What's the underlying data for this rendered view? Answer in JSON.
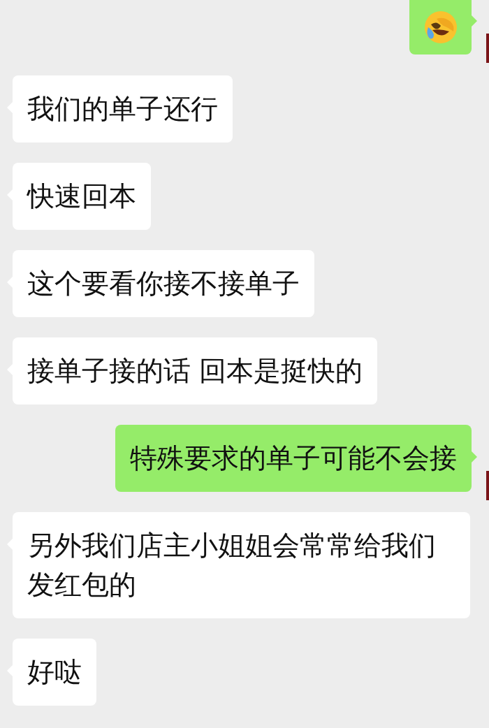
{
  "messages": [
    {
      "kind": "emoji",
      "outgoing": true
    },
    {
      "kind": "text",
      "outgoing": false,
      "text": "我们的单子还行"
    },
    {
      "kind": "text",
      "outgoing": false,
      "text": "快速回本"
    },
    {
      "kind": "text",
      "outgoing": false,
      "text": "这个要看你接不接单子"
    },
    {
      "kind": "text",
      "outgoing": false,
      "text": "接单子接的话 回本是挺快的"
    },
    {
      "kind": "text",
      "outgoing": true,
      "text": "特殊要求的单子可能不会接"
    },
    {
      "kind": "text",
      "outgoing": false,
      "text": "另外我们店主小姐姐会常常给我们发红包的"
    },
    {
      "kind": "text",
      "outgoing": false,
      "text": "好哒"
    }
  ]
}
